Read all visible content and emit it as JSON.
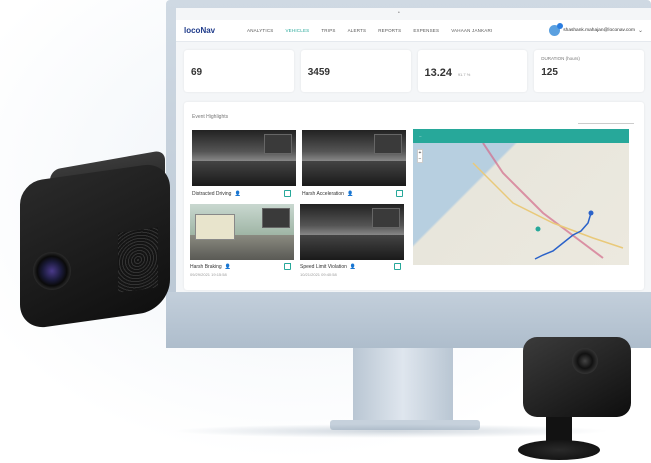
{
  "app": {
    "logo": "locoNav",
    "nav": [
      "ANALYTICS",
      "VEHICLES",
      "TRIPS",
      "ALERTS",
      "REPORTS",
      "EXPENSES",
      "VAHAAN JANKARI"
    ],
    "active_nav": "VEHICLES",
    "user_email": "shashank.mahajan@loconav.com"
  },
  "stats": [
    {
      "label": "",
      "value": "69",
      "sub": ""
    },
    {
      "label": "",
      "value": "3459",
      "sub": ""
    },
    {
      "label": "",
      "value": "13.24",
      "sub": "91.7 %"
    },
    {
      "label": "DURATION (hours)",
      "value": "125",
      "sub": ""
    }
  ],
  "panel": {
    "title": "Event Highlights",
    "select_value": ""
  },
  "events": [
    {
      "caption": "Distracted Driving",
      "timestamp": ""
    },
    {
      "caption": "Harsh Acceleration",
      "timestamp": ""
    },
    {
      "caption": "Harsh Braking",
      "timestamp": "09/29/2021 19:15:58"
    },
    {
      "caption": "Speed Limit Violation",
      "timestamp": "10/21/2021 09:40:58"
    }
  ],
  "map": {
    "header_left": "",
    "header_right": ""
  },
  "colors": {
    "accent": "#27a89a",
    "brand": "#1f3b8a"
  }
}
